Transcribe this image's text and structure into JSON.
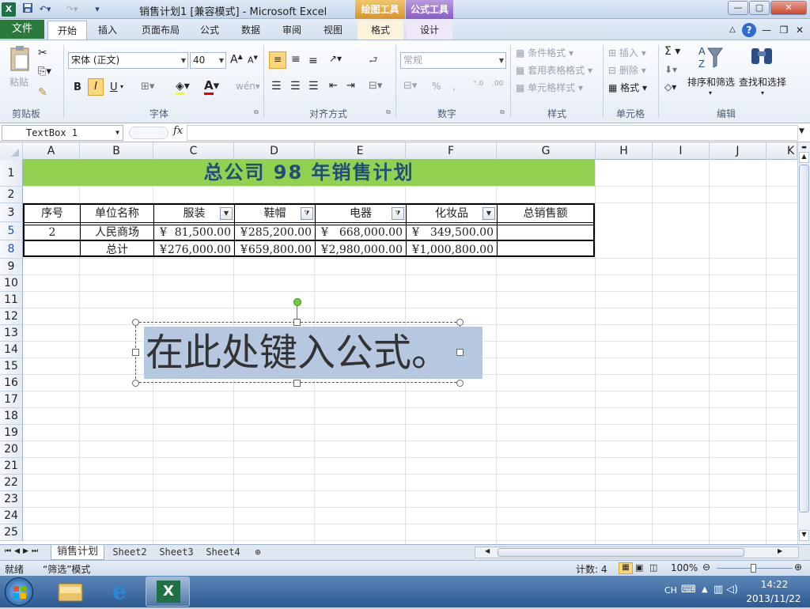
{
  "window": {
    "title": "销售计划1  [兼容模式] - Microsoft Excel",
    "context_tabs": [
      {
        "label": "绘图工具",
        "color": "#e0a53b"
      },
      {
        "label": "公式工具",
        "color": "#9166c4"
      }
    ],
    "app_icon": "X"
  },
  "ribbon_tabs": {
    "file": "文件",
    "items": [
      "开始",
      "插入",
      "页面布局",
      "公式",
      "数据",
      "审阅",
      "视图"
    ],
    "context_items": [
      "格式",
      "设计"
    ],
    "active": "开始"
  },
  "ribbon": {
    "clipboard": {
      "paste": "粘贴",
      "label": "剪贴板"
    },
    "font": {
      "name": "宋体 (正文)",
      "size": "40",
      "bold": "B",
      "italic": "I",
      "underline": "U",
      "label": "字体"
    },
    "alignment": {
      "label": "对齐方式"
    },
    "number": {
      "format": "常规",
      "percent": "%",
      "comma": ",",
      "label": "数字"
    },
    "styles": {
      "conditional": "条件格式",
      "table": "套用表格格式",
      "cell": "单元格样式",
      "label": "样式"
    },
    "cells": {
      "insert": "插入",
      "delete": "删除",
      "format": "格式",
      "label": "单元格"
    },
    "editing": {
      "sigma": "Σ",
      "sort": "排序和筛选",
      "find": "查找和选择",
      "label": "编辑"
    }
  },
  "formula_bar": {
    "name_box": "TextBox 1",
    "fx": "fx",
    "value": ""
  },
  "sheet": {
    "columns": [
      "A",
      "B",
      "C",
      "D",
      "E",
      "F",
      "G",
      "H",
      "I",
      "J",
      "K"
    ],
    "rows": [
      "1",
      "2",
      "3",
      "5",
      "8",
      "9",
      "10",
      "11",
      "12",
      "13",
      "14",
      "15",
      "16",
      "17",
      "18",
      "19",
      "20",
      "21",
      "22",
      "23",
      "24",
      "25"
    ],
    "title": "总公司 98 年销售计划",
    "header": [
      "序号",
      "单位名称",
      "服装",
      "鞋帽",
      "电器",
      "化妆品",
      "总销售额"
    ],
    "row5": [
      "2",
      "人民商场",
      "¥",
      "81,500.00",
      "¥",
      "285,200.00",
      "¥",
      "668,000.00",
      "¥",
      "349,500.00"
    ],
    "row8": [
      "",
      "总计",
      "¥",
      "276,000.00",
      "¥",
      "659,800.00",
      "¥",
      "2,980,000.00",
      "¥",
      "1,000,800.00"
    ]
  },
  "textbox": {
    "text": "在此处键入公式。"
  },
  "sheet_tabs": [
    "销售计划",
    "Sheet2",
    "Sheet3",
    "Sheet4"
  ],
  "status": {
    "ready": "就绪",
    "mode": "“筛选”模式",
    "count": "计数: 4",
    "zoom": "100%"
  },
  "taskbar": {
    "lang": "CH",
    "time": "14:22",
    "date": "2013/11/22"
  }
}
